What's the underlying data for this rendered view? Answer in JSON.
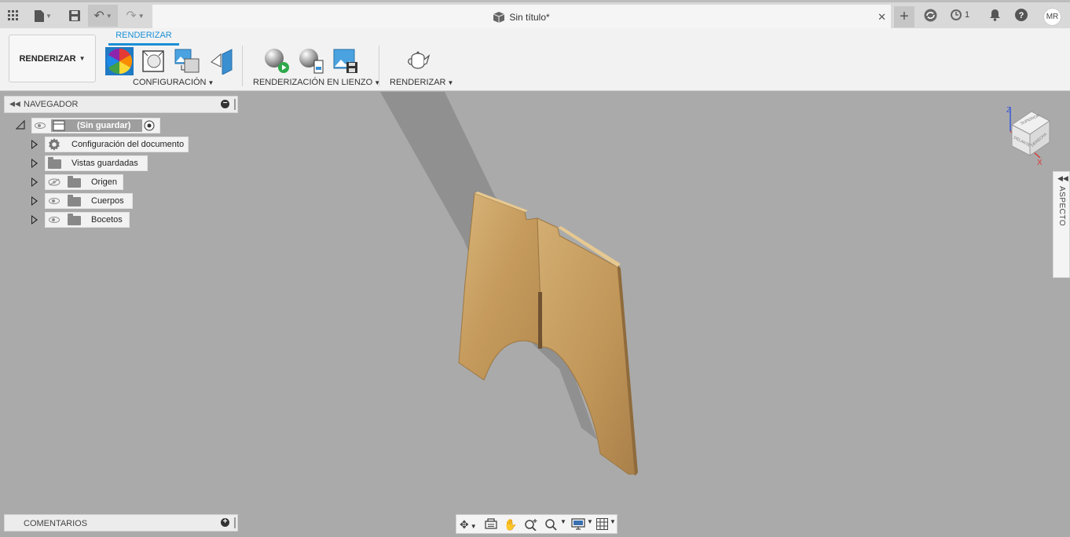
{
  "title_bar": {
    "document_title": "Sin título*",
    "jobs_count": "1",
    "user_initials": "MR",
    "icons": [
      "grid-icon",
      "file-icon",
      "save-icon",
      "undo-icon",
      "redo-icon",
      "close-icon",
      "plus-icon",
      "sync-icon",
      "clock-icon",
      "bell-icon",
      "help-icon"
    ]
  },
  "ribbon": {
    "workspace_label": "RENDERIZAR",
    "active_tab": "RENDERIZAR",
    "groups": {
      "config": "CONFIGURACIÓN",
      "canvas_render": "RENDERIZACIÓN EN LIENZO",
      "render": "RENDERIZAR"
    }
  },
  "navigator": {
    "title": "NAVEGADOR",
    "root_label": "(Sin guardar)",
    "items": [
      {
        "label": "Configuración del documento",
        "icon": "gear-icon"
      },
      {
        "label": "Vistas guardadas",
        "icon": "folder-icon"
      },
      {
        "label": "Origen",
        "icon": "folder-icon",
        "visibility": "hidden"
      },
      {
        "label": "Cuerpos",
        "icon": "folder-icon",
        "visibility": "visible"
      },
      {
        "label": "Bocetos",
        "icon": "folder-icon",
        "visibility": "visible"
      }
    ]
  },
  "comments": {
    "title": "COMENTARIOS"
  },
  "aspect_panel": {
    "label": "ASPECTO"
  },
  "viewcube": {
    "front": "DELANTE",
    "right": "DERECHA",
    "top": "SUPERIOR",
    "axis_z": "Z",
    "axis_x": "X"
  },
  "colors": {
    "accent": "#1a8fd6",
    "canvas": "#aaaaaa",
    "wood": "#c9a064"
  }
}
